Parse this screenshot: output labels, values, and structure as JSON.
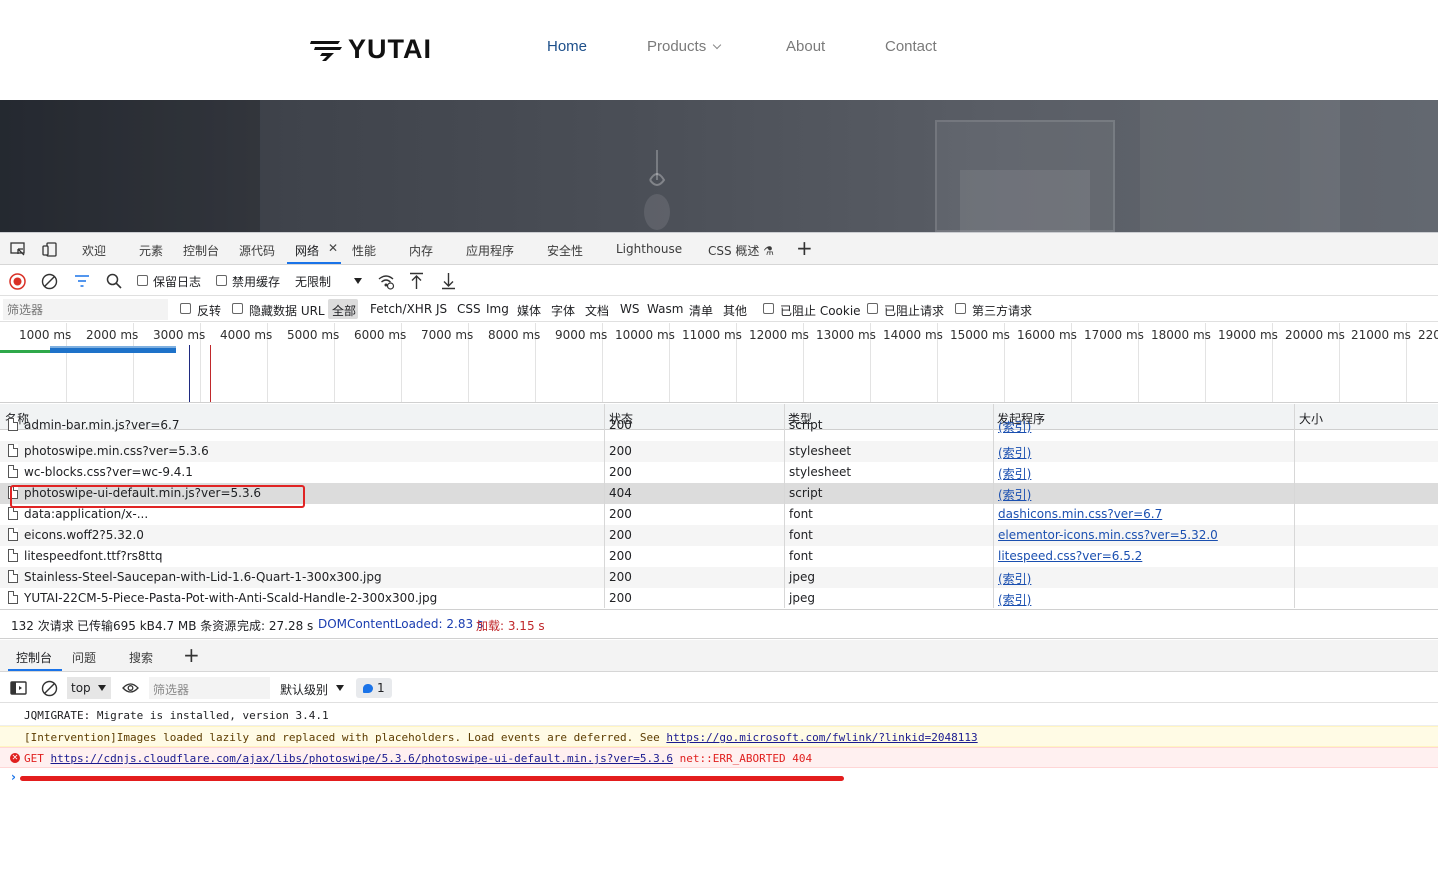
{
  "site": {
    "logo_text": "YUTAI",
    "nav": [
      {
        "label": "Home",
        "active": true
      },
      {
        "label": "Products",
        "dropdown": true
      },
      {
        "label": "About"
      },
      {
        "label": "Contact"
      }
    ]
  },
  "devtools": {
    "tabs": [
      "欢迎",
      "元素",
      "控制台",
      "源代码",
      "网络",
      "性能",
      "内存",
      "应用程序",
      "安全性",
      "Lighthouse",
      "CSS 概述"
    ],
    "active_tab": "网络",
    "toolbar": {
      "preserve_log": "保留日志",
      "disable_cache": "禁用缓存",
      "throttling": "无限制"
    },
    "filter": {
      "placeholder": "筛选器",
      "invert": "反转",
      "hide_data_urls": "隐藏数据 URL",
      "types": [
        "全部",
        "Fetch/XHR",
        "JS",
        "CSS",
        "Img",
        "媒体",
        "字体",
        "文档",
        "WS",
        "Wasm",
        "清单",
        "其他"
      ],
      "blocked_cookies": "已阻止 Cookie",
      "blocked_requests": "已阻止请求",
      "third_party": "第三方请求"
    },
    "timeline": {
      "ticks": [
        "1000 ms",
        "2000 ms",
        "3000 ms",
        "4000 ms",
        "5000 ms",
        "6000 ms",
        "7000 ms",
        "8000 ms",
        "9000 ms",
        "10000 ms",
        "11000 ms",
        "12000 ms",
        "13000 ms",
        "14000 ms",
        "15000 ms",
        "16000 ms",
        "17000 ms",
        "18000 ms",
        "19000 ms",
        "20000 ms",
        "21000 ms",
        "220"
      ]
    },
    "table": {
      "headers": {
        "name": "名称",
        "status": "状态",
        "type": "类型",
        "initiator": "发起程序",
        "size": "大小"
      },
      "rows": [
        {
          "name": "admin-bar.min.js?ver=6.7",
          "status": "200",
          "type": "script",
          "initiator": "(索引)"
        },
        {
          "name": "photoswipe.min.css?ver=5.3.6",
          "status": "200",
          "type": "stylesheet",
          "initiator": "(索引)"
        },
        {
          "name": "wc-blocks.css?ver=wc-9.4.1",
          "status": "200",
          "type": "stylesheet",
          "initiator": "(索引)"
        },
        {
          "name": "photoswipe-ui-default.min.js?ver=5.3.6",
          "status": "404",
          "type": "script",
          "initiator": "(索引)"
        },
        {
          "name": "data:application/x-...",
          "status": "200",
          "type": "font",
          "initiator": "dashicons.min.css?ver=6.7"
        },
        {
          "name": "eicons.woff2?5.32.0",
          "status": "200",
          "type": "font",
          "initiator": "elementor-icons.min.css?ver=5.32.0"
        },
        {
          "name": "litespeedfont.ttf?rs8ttq",
          "status": "200",
          "type": "font",
          "initiator": "litespeed.css?ver=6.5.2"
        },
        {
          "name": "Stainless-Steel-Saucepan-with-Lid-1.6-Quart-1-300x300.jpg",
          "status": "200",
          "type": "jpeg",
          "initiator": "(索引)"
        },
        {
          "name": "YUTAI-22CM-5-Piece-Pasta-Pot-with-Anti-Scald-Handle-2-300x300.jpg",
          "status": "200",
          "type": "jpeg",
          "initiator": "(索引)"
        }
      ]
    },
    "summary": {
      "requests": "132 次请求",
      "transferred": "已传输695 kB",
      "resources": "4.7 MB 条资源",
      "finish": "完成: 27.28 s",
      "dcl": "DOMContentLoaded: 2.83 s",
      "load": "加载: 3.15 s"
    },
    "drawer": {
      "tabs": [
        "控制台",
        "问题",
        "搜索"
      ],
      "context": "top",
      "filter_placeholder": "筛选器",
      "levels": "默认级别",
      "issues_count": "1"
    },
    "console": {
      "messages": [
        {
          "level": "info",
          "text": "JQMIGRATE: Migrate is installed, version 3.4.1"
        },
        {
          "level": "warn",
          "text": "[Intervention]Images loaded lazily and replaced with placeholders. Load events are deferred. See ",
          "link": "https://go.microsoft.com/fwlink/?linkid=2048113"
        },
        {
          "level": "error",
          "prefix": "GET ",
          "link": "https://cdnjs.cloudflare.com/ajax/libs/photoswipe/5.3.6/photoswipe-ui-default.min.js?ver=5.3.6",
          "suffix": " net::ERR_ABORTED 404"
        }
      ]
    }
  },
  "colors": {
    "accent": "#1a73e8",
    "nav_active": "#1d4f8a",
    "error": "#e0201f",
    "annotation_red": "#e31d1d"
  }
}
